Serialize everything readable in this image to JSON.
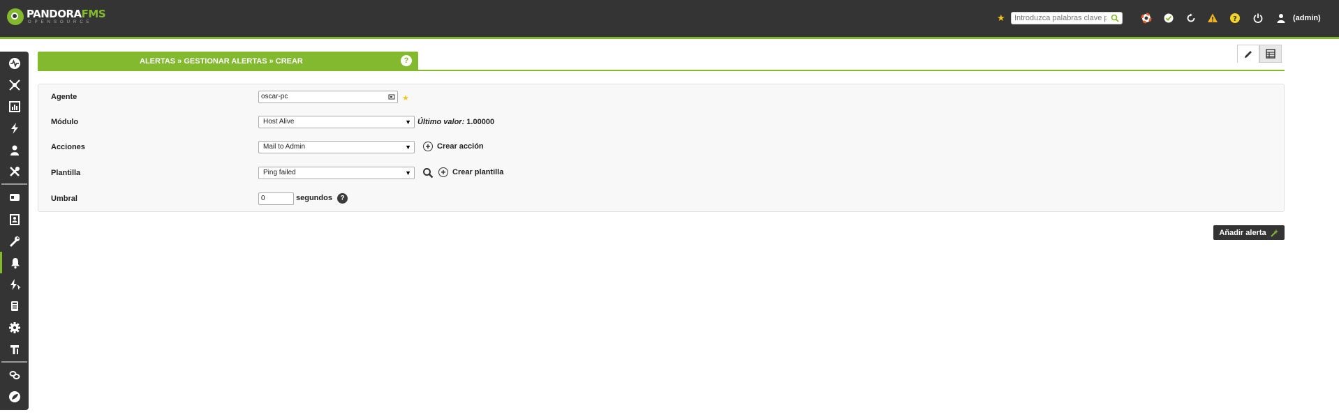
{
  "app": {
    "logo_main": "PANDORA",
    "logo_fms": "FMS",
    "logo_sub": "OPENSOURCE"
  },
  "topbar": {
    "search_placeholder": "Introduzca palabras clave para buscar",
    "user_label": "(admin)",
    "icons": [
      "star-icon",
      "search-icon",
      "lifebuoy-icon",
      "check-icon",
      "refresh-icon",
      "warning-icon",
      "help-icon",
      "power-icon",
      "user-icon"
    ]
  },
  "sidebar": {
    "items": [
      "monitoring-icon",
      "network-icon",
      "reports-icon",
      "events-icon",
      "users-icon",
      "tools-icon",
      "servers-icon",
      "contact-icon",
      "wrench-icon",
      "alerts-icon",
      "alert-bolt-icon",
      "device-icon",
      "settings-icon",
      "hammer-icon",
      "links-icon",
      "pandora-icon"
    ],
    "active": "alerts-icon"
  },
  "header": {
    "breadcrumb": "ALERTAS » GESTIONAR ALERTAS » CREAR",
    "help": "?"
  },
  "tabs": [
    "edit-icon",
    "list-icon"
  ],
  "form": {
    "agent_label": "Agente",
    "agent_value": "oscar-pc",
    "module_label": "Módulo",
    "module_value": "Host Alive",
    "last_value_label": "Último valor:",
    "last_value": "1.00000",
    "actions_label": "Acciones",
    "actions_value": "Mail to Admin",
    "create_action": "Crear acción",
    "template_label": "Plantilla",
    "template_value": "Ping failed",
    "create_template": "Crear plantilla",
    "threshold_label": "Umbral",
    "threshold_value": "0",
    "threshold_unit": "segundos",
    "threshold_help": "?"
  },
  "submit": {
    "label": "Añadir alerta"
  },
  "colors": {
    "accent": "#82b92e",
    "dark": "#343434"
  }
}
